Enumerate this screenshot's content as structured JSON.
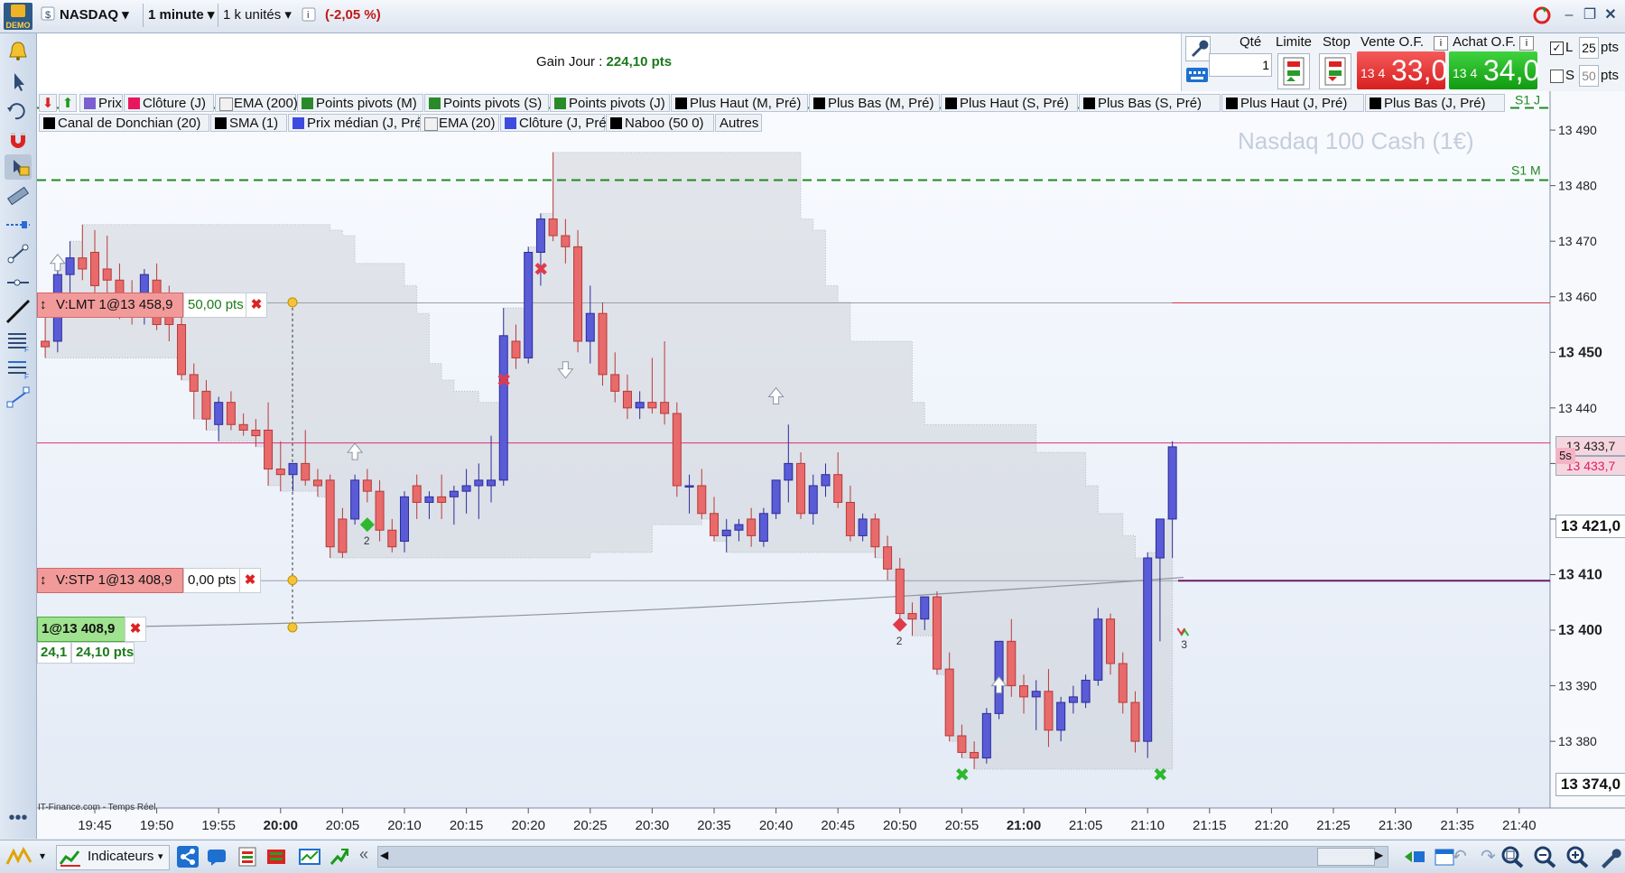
{
  "toolbar": {
    "demo_label": "DEMO",
    "instrument": "NASDAQ",
    "timeframe": "1 minute",
    "units": "1 k unités",
    "change": "(-2,05 %)"
  },
  "header": {
    "gain_label": "Gain Jour : ",
    "gain_value": "224,10 pts"
  },
  "order_panel": {
    "qty_label": "Qté",
    "qty_value": "1",
    "limit_label": "Limite",
    "stop_label": "Stop",
    "sell_label": "Vente O.F.",
    "buy_label": "Achat O.F.",
    "sell_prefix": "13 4",
    "sell_price": "33,0",
    "buy_prefix": "13 4",
    "buy_price": "34,0",
    "l_label": "L",
    "l_value": "25",
    "s_label": "S",
    "s_value": "50",
    "pts": "pts"
  },
  "legend": [
    {
      "label": "Prix",
      "color": "#7b5fd0"
    },
    {
      "label": "Clôture (J)",
      "color": "#e8175d"
    },
    {
      "label": "EMA (200)",
      "color": "#f1f1f1"
    },
    {
      "label": "Points pivots (M)",
      "color": "#2a8a2a"
    },
    {
      "label": "Points pivots (S)",
      "color": "#2a8a2a"
    },
    {
      "label": "Points pivots (J)",
      "color": "#2a8a2a"
    },
    {
      "label": "Plus Haut (M, Pré)",
      "color": "#000000"
    },
    {
      "label": "Plus Bas (M, Pré)",
      "color": "#000000"
    },
    {
      "label": "Plus Haut (S, Pré)",
      "color": "#000000"
    },
    {
      "label": "Plus Bas (S, Pré)",
      "color": "#000000"
    },
    {
      "label": "Plus Haut (J, Pré)",
      "color": "#000000"
    },
    {
      "label": "Plus Bas (J, Pré)",
      "color": "#000000"
    },
    {
      "label": "Canal de Donchian (20)",
      "color": "#000000"
    },
    {
      "label": "SMA (1)",
      "color": "#000000"
    },
    {
      "label": "Prix médian (J, Pré)",
      "color": "#3f4be0"
    },
    {
      "label": "EMA (20)",
      "color": "#f1f1f1"
    },
    {
      "label": "Clôture (J, Pré)",
      "color": "#3f4be0"
    },
    {
      "label": "Naboo (50 0)",
      "color": "#000000"
    }
  ],
  "legend_more": "Autres",
  "orders": {
    "limit_tag": "V:LMT 1@13 458,9",
    "limit_pts": "50,00 pts",
    "stop_tag": "V:STP 1@13 408,9",
    "stop_pts": "0,00 pts",
    "position_tag": "1@13 408,9",
    "position_val1": "24,1",
    "position_val2": "24,10 pts"
  },
  "watermark": "Nasdaq 100 Cash (1€)",
  "pivot_labels": {
    "s1j": "S1 J",
    "s1m": "S1 M"
  },
  "marker_counts": {
    "m1": "2",
    "m2": "2",
    "m3": "3"
  },
  "source": "IT-Finance.com - Temps Réel",
  "price_axis": {
    "current_top": "13 433,7",
    "current_bottom": "13 433,7",
    "timer": "5s",
    "bold_a": "13 421,0",
    "bold_b": "13 374,0",
    "bold_c": "13 450"
  },
  "bottom": {
    "indicators": "Indicateurs"
  },
  "chart_data": {
    "type": "candlestick",
    "ylim": [
      13368,
      13497
    ],
    "y_ticks": [
      13380,
      13390,
      13400,
      13410,
      13420,
      13430,
      13440,
      13450,
      13460,
      13470,
      13480,
      13490
    ],
    "y_tick_labels": [
      "13 380",
      "13 390",
      "13 400",
      "13 410",
      "13 420",
      "13 430",
      "13 440",
      "13 450",
      "13 460",
      "13 470",
      "13 480",
      "13 490"
    ],
    "x_start": "19:40",
    "x_ticks": [
      "19:45",
      "19:50",
      "19:55",
      "20:00",
      "20:05",
      "20:10",
      "20:15",
      "20:20",
      "20:25",
      "20:30",
      "20:35",
      "20:40",
      "20:45",
      "20:50",
      "20:55",
      "21:00",
      "21:05",
      "21:10",
      "21:15",
      "21:20",
      "21:25",
      "21:30",
      "21:35",
      "21:40"
    ],
    "candles": [
      {
        "o": 13452,
        "h": 13457,
        "l": 13449,
        "c": 13451
      },
      {
        "o": 13452,
        "h": 13466,
        "l": 13450,
        "c": 13464
      },
      {
        "o": 13464,
        "h": 13470,
        "l": 13460,
        "c": 13467
      },
      {
        "o": 13467,
        "h": 13473,
        "l": 13463,
        "c": 13465
      },
      {
        "o": 13468,
        "h": 13472,
        "l": 13460,
        "c": 13462
      },
      {
        "o": 13465,
        "h": 13471,
        "l": 13458,
        "c": 13463
      },
      {
        "o": 13463,
        "h": 13466,
        "l": 13456,
        "c": 13458
      },
      {
        "o": 13458,
        "h": 13463,
        "l": 13455,
        "c": 13457
      },
      {
        "o": 13457,
        "h": 13465,
        "l": 13455,
        "c": 13464
      },
      {
        "o": 13463,
        "h": 13466,
        "l": 13454,
        "c": 13455
      },
      {
        "o": 13458,
        "h": 13462,
        "l": 13452,
        "c": 13455
      },
      {
        "o": 13455,
        "h": 13457,
        "l": 13445,
        "c": 13446
      },
      {
        "o": 13446,
        "h": 13448,
        "l": 13438,
        "c": 13443
      },
      {
        "o": 13443,
        "h": 13445,
        "l": 13436,
        "c": 13438
      },
      {
        "o": 13437,
        "h": 13442,
        "l": 13434,
        "c": 13441
      },
      {
        "o": 13441,
        "h": 13443,
        "l": 13436,
        "c": 13437
      },
      {
        "o": 13437,
        "h": 13439,
        "l": 13435,
        "c": 13436
      },
      {
        "o": 13436,
        "h": 13438,
        "l": 13433,
        "c": 13435
      },
      {
        "o": 13436,
        "h": 13441,
        "l": 13426,
        "c": 13429
      },
      {
        "o": 13429,
        "h": 13434,
        "l": 13425,
        "c": 13428
      },
      {
        "o": 13428,
        "h": 13430,
        "l": 13425,
        "c": 13430
      },
      {
        "o": 13430,
        "h": 13436,
        "l": 13426,
        "c": 13427
      },
      {
        "o": 13427,
        "h": 13429,
        "l": 13424,
        "c": 13426
      },
      {
        "o": 13427,
        "h": 13428,
        "l": 13413,
        "c": 13415
      },
      {
        "o": 13420,
        "h": 13422,
        "l": 13413,
        "c": 13414
      },
      {
        "o": 13420,
        "h": 13428,
        "l": 13419,
        "c": 13427
      },
      {
        "o": 13427,
        "h": 13429,
        "l": 13423,
        "c": 13425
      },
      {
        "o": 13425,
        "h": 13427,
        "l": 13416,
        "c": 13418
      },
      {
        "o": 13418,
        "h": 13420,
        "l": 13414,
        "c": 13415
      },
      {
        "o": 13416,
        "h": 13425,
        "l": 13414,
        "c": 13424
      },
      {
        "o": 13426,
        "h": 13428,
        "l": 13420,
        "c": 13423
      },
      {
        "o": 13423,
        "h": 13425,
        "l": 13420,
        "c": 13424
      },
      {
        "o": 13424,
        "h": 13428,
        "l": 13420,
        "c": 13423
      },
      {
        "o": 13424,
        "h": 13426,
        "l": 13419,
        "c": 13425
      },
      {
        "o": 13425,
        "h": 13429,
        "l": 13421,
        "c": 13426
      },
      {
        "o": 13426,
        "h": 13430,
        "l": 13420,
        "c": 13427
      },
      {
        "o": 13426,
        "h": 13435,
        "l": 13423,
        "c": 13427
      },
      {
        "o": 13427,
        "h": 13458,
        "l": 13426,
        "c": 13453
      },
      {
        "o": 13452,
        "h": 13455,
        "l": 13447,
        "c": 13449
      },
      {
        "o": 13449,
        "h": 13469,
        "l": 13448,
        "c": 13468
      },
      {
        "o": 13468,
        "h": 13475,
        "l": 13462,
        "c": 13474
      },
      {
        "o": 13474,
        "h": 13486,
        "l": 13470,
        "c": 13471
      },
      {
        "o": 13471,
        "h": 13474,
        "l": 13466,
        "c": 13469
      },
      {
        "o": 13469,
        "h": 13472,
        "l": 13450,
        "c": 13452
      },
      {
        "o": 13452,
        "h": 13462,
        "l": 13448,
        "c": 13457
      },
      {
        "o": 13457,
        "h": 13459,
        "l": 13444,
        "c": 13446
      },
      {
        "o": 13446,
        "h": 13450,
        "l": 13441,
        "c": 13443
      },
      {
        "o": 13443,
        "h": 13446,
        "l": 13438,
        "c": 13440
      },
      {
        "o": 13440,
        "h": 13443,
        "l": 13438,
        "c": 13441
      },
      {
        "o": 13441,
        "h": 13449,
        "l": 13439,
        "c": 13440
      },
      {
        "o": 13441,
        "h": 13452,
        "l": 13437,
        "c": 13439
      },
      {
        "o": 13439,
        "h": 13441,
        "l": 13424,
        "c": 13426
      },
      {
        "o": 13426,
        "h": 13428,
        "l": 13421,
        "c": 13426
      },
      {
        "o": 13426,
        "h": 13429,
        "l": 13420,
        "c": 13421
      },
      {
        "o": 13421,
        "h": 13424,
        "l": 13416,
        "c": 13417
      },
      {
        "o": 13417,
        "h": 13420,
        "l": 13414,
        "c": 13418
      },
      {
        "o": 13418,
        "h": 13420,
        "l": 13416,
        "c": 13419
      },
      {
        "o": 13420,
        "h": 13422,
        "l": 13415,
        "c": 13417
      },
      {
        "o": 13416,
        "h": 13422,
        "l": 13415,
        "c": 13421
      },
      {
        "o": 13421,
        "h": 13427,
        "l": 13420,
        "c": 13427
      },
      {
        "o": 13427,
        "h": 13437,
        "l": 13423,
        "c": 13430
      },
      {
        "o": 13430,
        "h": 13432,
        "l": 13420,
        "c": 13421
      },
      {
        "o": 13421,
        "h": 13428,
        "l": 13419,
        "c": 13426
      },
      {
        "o": 13426,
        "h": 13430,
        "l": 13424,
        "c": 13428
      },
      {
        "o": 13428,
        "h": 13432,
        "l": 13422,
        "c": 13423
      },
      {
        "o": 13423,
        "h": 13426,
        "l": 13416,
        "c": 13417
      },
      {
        "o": 13417,
        "h": 13421,
        "l": 13416,
        "c": 13420
      },
      {
        "o": 13420,
        "h": 13421,
        "l": 13413,
        "c": 13415
      },
      {
        "o": 13415,
        "h": 13417,
        "l": 13409,
        "c": 13411
      },
      {
        "o": 13411,
        "h": 13413,
        "l": 13402,
        "c": 13403
      },
      {
        "o": 13403,
        "h": 13405,
        "l": 13399,
        "c": 13402
      },
      {
        "o": 13402,
        "h": 13406,
        "l": 13400,
        "c": 13406
      },
      {
        "o": 13406,
        "h": 13407,
        "l": 13392,
        "c": 13393
      },
      {
        "o": 13393,
        "h": 13396,
        "l": 13380,
        "c": 13381
      },
      {
        "o": 13381,
        "h": 13383,
        "l": 13377,
        "c": 13378
      },
      {
        "o": 13378,
        "h": 13380,
        "l": 13375,
        "c": 13377
      },
      {
        "o": 13377,
        "h": 13386,
        "l": 13376,
        "c": 13385
      },
      {
        "o": 13385,
        "h": 13398,
        "l": 13384,
        "c": 13398
      },
      {
        "o": 13398,
        "h": 13402,
        "l": 13388,
        "c": 13390
      },
      {
        "o": 13390,
        "h": 13392,
        "l": 13385,
        "c": 13388
      },
      {
        "o": 13388,
        "h": 13391,
        "l": 13382,
        "c": 13389
      },
      {
        "o": 13389,
        "h": 13393,
        "l": 13379,
        "c": 13382
      },
      {
        "o": 13382,
        "h": 13388,
        "l": 13380,
        "c": 13387
      },
      {
        "o": 13387,
        "h": 13390,
        "l": 13385,
        "c": 13388
      },
      {
        "o": 13387,
        "h": 13392,
        "l": 13386,
        "c": 13391
      },
      {
        "o": 13391,
        "h": 13404,
        "l": 13390,
        "c": 13402
      },
      {
        "o": 13402,
        "h": 13403,
        "l": 13392,
        "c": 13394
      },
      {
        "o": 13394,
        "h": 13396,
        "l": 13385,
        "c": 13387
      },
      {
        "o": 13387,
        "h": 13389,
        "l": 13378,
        "c": 13380
      },
      {
        "o": 13380,
        "h": 13414,
        "l": 13377,
        "c": 13413
      },
      {
        "o": 13413,
        "h": 13420,
        "l": 13398,
        "c": 13420
      },
      {
        "o": 13420,
        "h": 13434,
        "l": 13413,
        "c": 13433
      }
    ],
    "levels": {
      "limit": 13458.9,
      "stop": 13408.9,
      "current": 13433.7,
      "s1j": 13494,
      "s1m": 13481
    },
    "markers": [
      {
        "kind": "up-arrow",
        "i": 1,
        "y": 13466
      },
      {
        "kind": "up-arrow",
        "i": 25,
        "y": 13432
      },
      {
        "kind": "diamond-green",
        "i": 26,
        "y": 13419,
        "label": "m1"
      },
      {
        "kind": "cross-red",
        "i": 40,
        "y": 13465
      },
      {
        "kind": "down-arrow",
        "i": 42,
        "y": 13447
      },
      {
        "kind": "cross-red",
        "i": 37,
        "y": 13445
      },
      {
        "kind": "up-arrow",
        "i": 59,
        "y": 13442
      },
      {
        "kind": "diamond-red",
        "i": 69,
        "y": 13401,
        "label": "m2"
      },
      {
        "kind": "up-arrow",
        "i": 77,
        "y": 13390
      },
      {
        "kind": "cross-green",
        "i": 74,
        "y": 13374
      },
      {
        "kind": "cross-green",
        "i": 90,
        "y": 13374
      },
      {
        "kind": "arrows-pair",
        "i": 92,
        "y": 13400,
        "label": "m3"
      }
    ]
  }
}
